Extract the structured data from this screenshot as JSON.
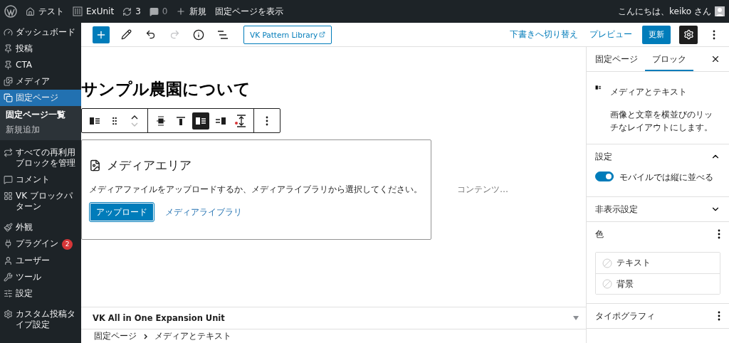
{
  "admin_bar": {
    "items": [
      {
        "kind": "home",
        "label": "テスト"
      },
      {
        "kind": "exunit",
        "label": "ExUnit"
      },
      {
        "kind": "updates",
        "label": "3"
      },
      {
        "kind": "comments",
        "label": "0"
      },
      {
        "kind": "new",
        "label": "新規"
      },
      {
        "kind": "plain",
        "label": "固定ページを表示"
      }
    ],
    "greeting": "こんにちは、keiko さん"
  },
  "admin_menu": [
    {
      "label": "ダッシュボード",
      "selected": false
    },
    {
      "label": "投稿",
      "selected": false
    },
    {
      "label": "CTA",
      "selected": false
    },
    {
      "label": "メディア",
      "selected": false
    },
    {
      "label": "固定ページ",
      "selected": true,
      "children": [
        {
          "label": "固定ページ一覧",
          "selected": true
        },
        {
          "label": "新規追加",
          "selected": false
        }
      ]
    },
    {
      "label": "すべての再利用ブロックを管理",
      "selected": false
    },
    {
      "label": "コメント",
      "selected": false
    },
    {
      "label": "VK ブロックパターン",
      "selected": false
    },
    {
      "label": "外観",
      "selected": false
    },
    {
      "label": "プラグイン",
      "badge": "2",
      "selected": false
    },
    {
      "label": "ユーザー",
      "selected": false
    },
    {
      "label": "ツール",
      "selected": false
    },
    {
      "label": "設定",
      "selected": false
    },
    {
      "label": "カスタム投稿タイプ設定",
      "selected": false
    }
  ],
  "editor_header": {
    "pattern_library": "VK Pattern Library",
    "switch_to_draft": "下書きへ切り替え",
    "preview": "プレビュー",
    "update": "更新",
    "settings_open": true
  },
  "canvas": {
    "title": "サンプル農園について",
    "block_toolbar": [
      {
        "kind": "block",
        "selected": false
      },
      {
        "kind": "drag",
        "selected": false
      },
      {
        "kind": "move",
        "selected": false
      },
      {
        "kind": "align-center",
        "selected": false
      },
      {
        "kind": "align-top",
        "selected": false
      },
      {
        "kind": "media-left",
        "selected": true
      },
      {
        "kind": "media-right",
        "selected": false
      },
      {
        "kind": "height",
        "selected": false
      },
      {
        "kind": "more",
        "selected": false
      }
    ],
    "placeholder": {
      "title": "メディアエリア",
      "instructions": "メディアファイルをアップロードするか、メディアライブラリから選択してください。",
      "upload": "アップロード",
      "library": "メディアライブラリ"
    },
    "content_placeholder": "コンテンツ…"
  },
  "metabox": {
    "title": "VK All in One Expansion Unit",
    "expanded": false
  },
  "breadcrumb": [
    "固定ページ",
    "メディアとテキスト"
  ],
  "settings_sidebar": {
    "tabs": [
      {
        "label": "固定ページ",
        "selected": false
      },
      {
        "label": "ブロック",
        "selected": true
      }
    ],
    "block_card": {
      "name": "メディアとテキスト",
      "description": "画像と文章を横並びのリッチなレイアウトにします。"
    },
    "panels": [
      {
        "kind": "toggle",
        "title": "設定",
        "expanded": true,
        "toggle": {
          "label": "モバイルでは縦に並べる",
          "on": true
        }
      },
      {
        "kind": "toggle",
        "title": "非表示設定",
        "expanded": false
      },
      {
        "kind": "menu",
        "title": "色",
        "colors": [
          "テキスト",
          "背景"
        ]
      },
      {
        "kind": "menu",
        "title": "タイポグラフィ"
      }
    ]
  }
}
